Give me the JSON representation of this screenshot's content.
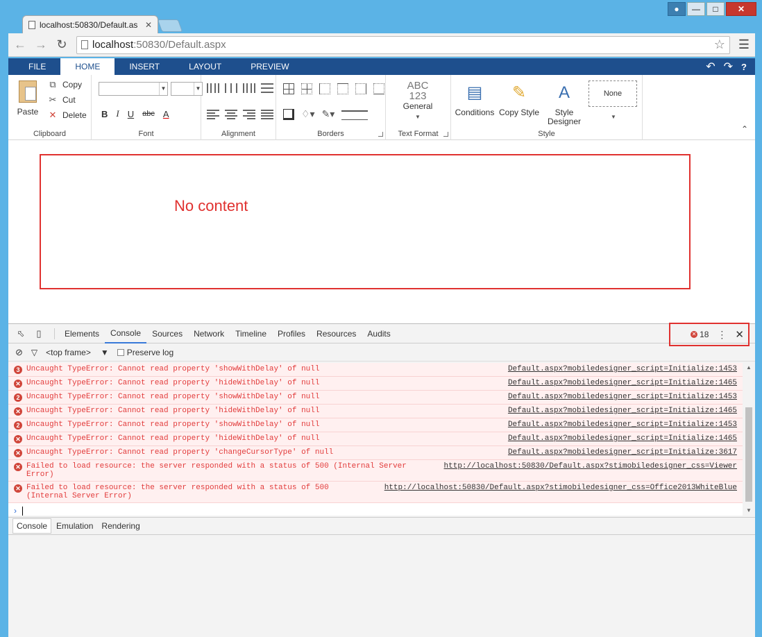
{
  "browser": {
    "tab_title": "localhost:50830/Default.as",
    "url_host": "localhost",
    "url_rest": ":50830/Default.aspx"
  },
  "ribbon": {
    "tabs": [
      "FILE",
      "HOME",
      "INSERT",
      "LAYOUT",
      "PREVIEW"
    ],
    "active_tab": "HOME",
    "help": "?",
    "clipboard": {
      "paste": "Paste",
      "copy": "Copy",
      "cut": "Cut",
      "delete": "Delete",
      "label": "Clipboard"
    },
    "font": {
      "label": "Font",
      "bold": "B",
      "italic": "I",
      "underline": "U",
      "strike": "abc",
      "color": "A"
    },
    "alignment": {
      "label": "Alignment"
    },
    "borders": {
      "label": "Borders"
    },
    "text_format": {
      "abc": "ABC",
      "num": "123",
      "value": "General",
      "label": "Text Format"
    },
    "style": {
      "conditions": "Conditions",
      "copy_style": "Copy Style",
      "style_designer": "Style Designer",
      "none": "None",
      "label": "Style"
    }
  },
  "content": {
    "message": "No content"
  },
  "devtools": {
    "tabs": [
      "Elements",
      "Console",
      "Sources",
      "Network",
      "Timeline",
      "Profiles",
      "Resources",
      "Audits"
    ],
    "active_tab": "Console",
    "error_count": "18",
    "frame": "<top frame>",
    "preserve_log": "Preserve log",
    "log": [
      {
        "count": "3",
        "msg": "Uncaught TypeError: Cannot read property 'showWithDelay' of null",
        "src": "Default.aspx?mobiledesigner_script=Initialize:1453"
      },
      {
        "count": "",
        "msg": "Uncaught TypeError: Cannot read property 'hideWithDelay' of null",
        "src": "Default.aspx?mobiledesigner_script=Initialize:1465"
      },
      {
        "count": "2",
        "msg": "Uncaught TypeError: Cannot read property 'showWithDelay' of null",
        "src": "Default.aspx?mobiledesigner_script=Initialize:1453"
      },
      {
        "count": "",
        "msg": "Uncaught TypeError: Cannot read property 'hideWithDelay' of null",
        "src": "Default.aspx?mobiledesigner_script=Initialize:1465"
      },
      {
        "count": "2",
        "msg": "Uncaught TypeError: Cannot read property 'showWithDelay' of null",
        "src": "Default.aspx?mobiledesigner_script=Initialize:1453"
      },
      {
        "count": "",
        "msg": "Uncaught TypeError: Cannot read property 'hideWithDelay' of null",
        "src": "Default.aspx?mobiledesigner_script=Initialize:1465"
      },
      {
        "count": "",
        "msg": "Uncaught TypeError: Cannot read property 'changeCursorType' of null",
        "src": "Default.aspx?mobiledesigner_script=Initialize:3617"
      },
      {
        "count": "",
        "msg": "Failed to load resource: the server responded with a status of 500 (Internal Server\nError)",
        "src": "http://localhost:50830/Default.aspx?stimobiledesigner_css=Viewer"
      },
      {
        "count": "",
        "msg": "Failed to load resource: the server responded with a status of 500\n(Internal Server Error)",
        "src": "http://localhost:50830/Default.aspx?stimobiledesigner_css=Office2013WhiteBlue"
      }
    ],
    "drawer_tabs": [
      "Console",
      "Emulation",
      "Rendering"
    ]
  }
}
